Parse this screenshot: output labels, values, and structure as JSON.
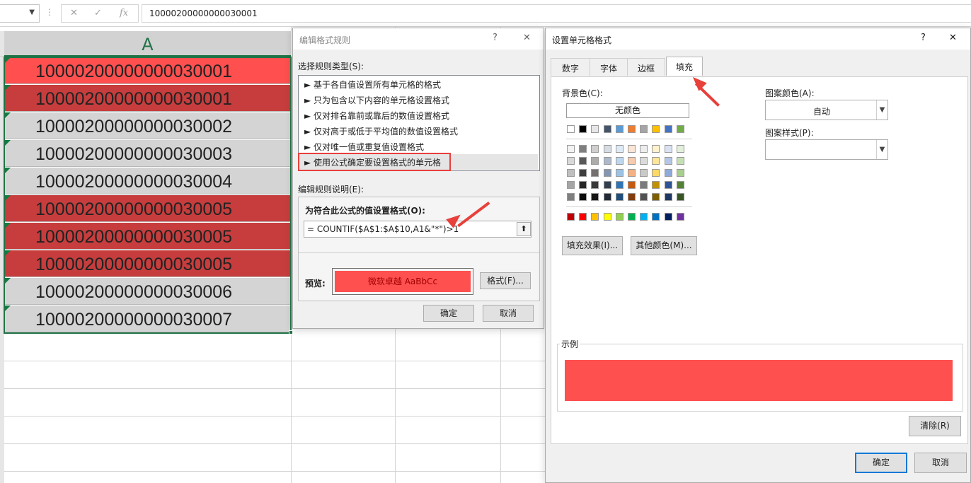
{
  "formula_bar": {
    "formula": "10000200000000030001",
    "cancel_icon": "✕",
    "enter_icon": "✓",
    "fx_icon": "fx"
  },
  "sheet": {
    "column_header": "A",
    "rows": [
      {
        "value": "10000200000000030001",
        "fill": "#ff4f4f"
      },
      {
        "value": "10000200000000030001",
        "fill": "#c73d3d"
      },
      {
        "value": "10000200000000030002",
        "fill": "#d4d4d4"
      },
      {
        "value": "10000200000000030003",
        "fill": "#d4d4d4"
      },
      {
        "value": "10000200000000030004",
        "fill": "#d4d4d4"
      },
      {
        "value": "10000200000000030005",
        "fill": "#c73d3d"
      },
      {
        "value": "10000200000000030005",
        "fill": "#c73d3d"
      },
      {
        "value": "10000200000000030005",
        "fill": "#c73d3d"
      },
      {
        "value": "10000200000000030006",
        "fill": "#d4d4d4"
      },
      {
        "value": "10000200000000030007",
        "fill": "#d4d4d4"
      }
    ]
  },
  "edit_rule_dialog": {
    "title": "编辑格式规则",
    "help": "?",
    "close": "✕",
    "select_type_label": "选择规则类型(S):",
    "rule_types": [
      "► 基于各自值设置所有单元格的格式",
      "► 只为包含以下内容的单元格设置格式",
      "► 仅对排名靠前或靠后的数值设置格式",
      "► 仅对高于或低于平均值的数值设置格式",
      "► 仅对唯一值或重复值设置格式",
      "► 使用公式确定要设置格式的单元格"
    ],
    "desc_label": "编辑规则说明(E):",
    "formula_label": "为符合此公式的值设置格式(O):",
    "formula_value": "= COUNTIF($A$1:$A$10,A1&\"*\")>1",
    "preview_label": "预览:",
    "preview_text": "微软卓越  AaBbCc",
    "preview_fill": "#ff5050",
    "format_button": "格式(F)...",
    "ok": "确定",
    "cancel": "取消"
  },
  "format_cells_dialog": {
    "title": "设置单元格格式",
    "help": "?",
    "close": "✕",
    "tabs": [
      "数字",
      "字体",
      "边框",
      "填充"
    ],
    "active_tab": "填充",
    "bg_color_label": "背景色(C):",
    "no_color_button": "无颜色",
    "theme_row": [
      "#ffffff",
      "#000000",
      "#e7e6e6",
      "#44546a",
      "#5b9bd5",
      "#ed7d31",
      "#a5a5a5",
      "#ffc000",
      "#4472c4",
      "#70ad47"
    ],
    "tint_rows": [
      [
        "#f2f2f2",
        "#7f7f7f",
        "#d0cece",
        "#d6dce4",
        "#deebf6",
        "#fbe5d5",
        "#ededed",
        "#fff2cc",
        "#d9e2f3",
        "#e2efd9"
      ],
      [
        "#d8d8d8",
        "#595959",
        "#aeabab",
        "#adb9ca",
        "#bdd7ee",
        "#f7cbac",
        "#dbdbdb",
        "#fee599",
        "#b4c6e7",
        "#c5e0b3"
      ],
      [
        "#bfbfbf",
        "#3f3f3f",
        "#757070",
        "#8496b0",
        "#9cc3e5",
        "#f4b183",
        "#c9c9c9",
        "#ffd965",
        "#8eaadb",
        "#a8d08d"
      ],
      [
        "#a5a5a5",
        "#262626",
        "#3a3838",
        "#323f4f",
        "#2e75b5",
        "#c55a11",
        "#7b7b7b",
        "#bf9000",
        "#2f5496",
        "#538135"
      ],
      [
        "#7f7f7f",
        "#0c0c0c",
        "#171616",
        "#222a35",
        "#1e4e79",
        "#833c0b",
        "#525252",
        "#7f6000",
        "#1f3864",
        "#375623"
      ]
    ],
    "standard_row": [
      "#c00000",
      "#ff0000",
      "#ffc000",
      "#ffff00",
      "#92d050",
      "#00b050",
      "#00b0f0",
      "#0070c0",
      "#002060",
      "#7030a0"
    ],
    "fill_effects_button": "填充效果(I)...",
    "more_colors_button": "其他颜色(M)...",
    "pattern_color_label": "图案颜色(A):",
    "pattern_color_value": "自动",
    "pattern_style_label": "图案样式(P):",
    "sample_label": "示例",
    "sample_fill": "#ff5050",
    "clear_button": "清除(R)",
    "ok": "确定",
    "cancel": "取消"
  }
}
